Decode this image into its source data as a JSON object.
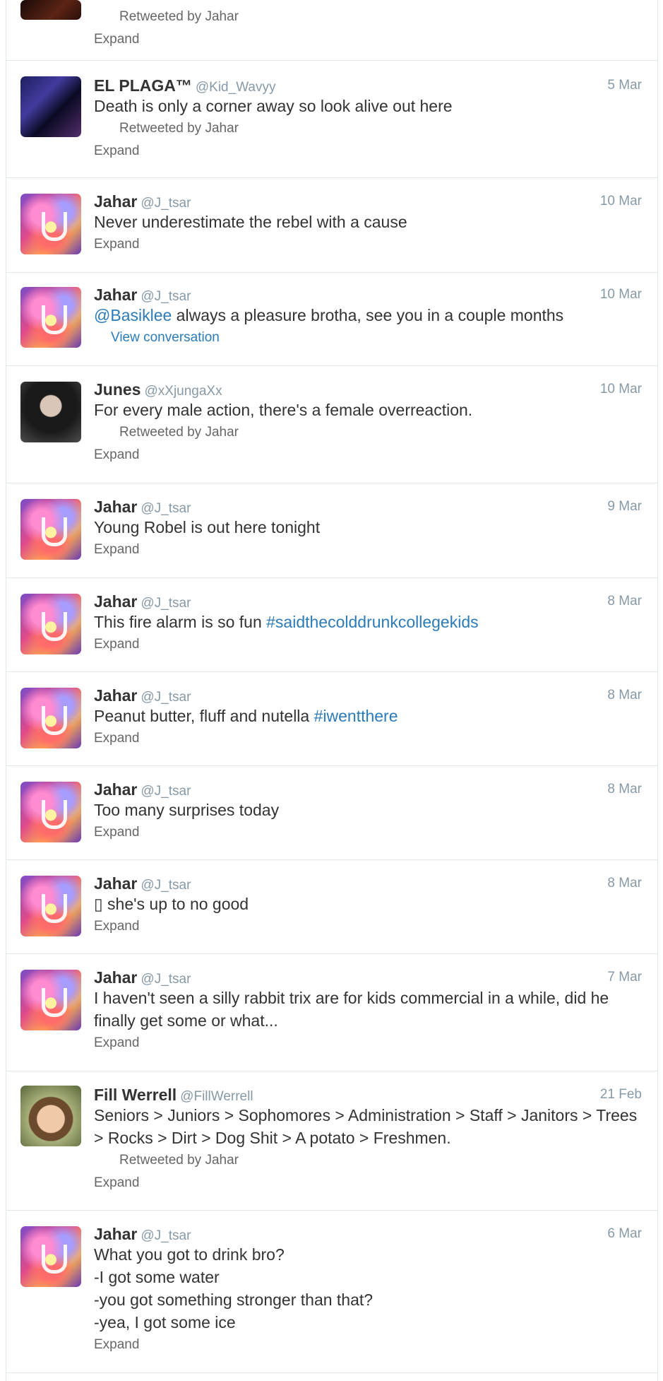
{
  "tweets": [
    {
      "name": "",
      "handle": "",
      "time": "",
      "retweeted": "Retweeted by Jahar",
      "footer": "Expand"
    },
    {
      "name": "EL PLAGA™",
      "handle": "@Kid_Wavyy",
      "time": "5 Mar",
      "text": "Death is only a corner away so look alive out here",
      "retweeted": "Retweeted by Jahar",
      "footer": "Expand"
    },
    {
      "name": "Jahar",
      "handle": "@J_tsar",
      "time": "10 Mar",
      "text": "Never underestimate the rebel with a cause",
      "footer": "Expand"
    },
    {
      "name": "Jahar",
      "handle": "@J_tsar",
      "time": "10 Mar",
      "mention": "@Basiklee",
      "text": " always a pleasure brotha, see you in a couple months",
      "footer": "View conversation"
    },
    {
      "name": "Junes",
      "handle": "@xXjungaXx",
      "time": "10 Mar",
      "text": "For every male action, there's a female overreaction.",
      "retweeted": "Retweeted by Jahar",
      "footer": "Expand"
    },
    {
      "name": "Jahar",
      "handle": "@J_tsar",
      "time": "9 Mar",
      "text": "Young Robel is out here tonight",
      "footer": "Expand"
    },
    {
      "name": "Jahar",
      "handle": "@J_tsar",
      "time": "8 Mar",
      "text": "This fire alarm is so fun ",
      "hashtag": "#saidthecolddrunkcollegekids",
      "footer": "Expand"
    },
    {
      "name": "Jahar",
      "handle": "@J_tsar",
      "time": "8 Mar",
      "text": "Peanut butter, fluff and nutella ",
      "hashtag": "#iwentthere",
      "footer": "Expand"
    },
    {
      "name": "Jahar",
      "handle": "@J_tsar",
      "time": "8 Mar",
      "text": "Too many surprises today",
      "footer": "Expand"
    },
    {
      "name": "Jahar",
      "handle": "@J_tsar",
      "time": "8 Mar",
      "text": "▯ she's up to no good",
      "footer": "Expand"
    },
    {
      "name": "Jahar",
      "handle": "@J_tsar",
      "time": "7 Mar",
      "text": "I haven't seen a silly rabbit trix are for kids commercial in a while, did he finally get some or what...",
      "footer": "Expand"
    },
    {
      "name": "Fill Werrell",
      "handle": "@FillWerrell",
      "time": "21 Feb",
      "text": "Seniors > Juniors > Sophomores > Administration > Staff > Janitors > Trees > Rocks > Dirt > Dog Shit > A potato > Freshmen.",
      "retweeted": "Retweeted by Jahar",
      "footer": "Expand"
    },
    {
      "name": "Jahar",
      "handle": "@J_tsar",
      "time": "6 Mar",
      "lines": [
        "What you got to drink bro?",
        "-I got some water",
        "-you got something stronger than that?",
        "-yea, I got some ice"
      ],
      "footer": "Expand"
    }
  ]
}
